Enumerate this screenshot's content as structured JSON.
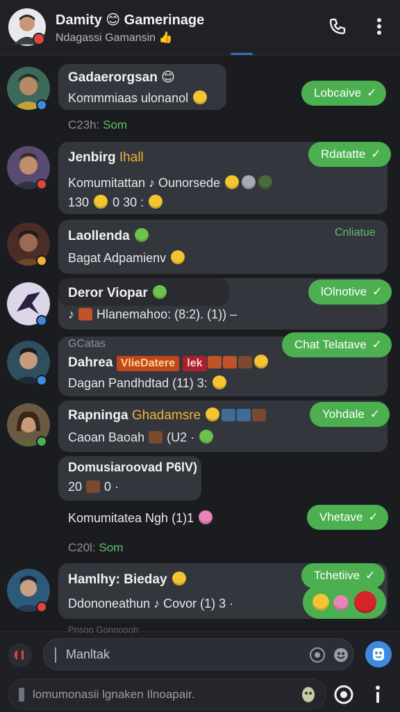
{
  "header": {
    "title": "Damity 😊 Gamerinage",
    "subtitle": "Ndagassi Gamansin 👍"
  },
  "messages": {
    "m1": {
      "name": "Gadaerorgsan 😊",
      "text": "Kommmiaas ulonanol",
      "time": "C23h:",
      "time_green": "Som",
      "status": "Lobcaive"
    },
    "m2": {
      "name": "Jenbirg",
      "name_gold": "Ihall",
      "text": "Komumitattan ♪ Ounorsede",
      "text2": "130 ",
      "text2b": "0 30 :",
      "status": "Rdatatte"
    },
    "m3": {
      "name": "Laollenda",
      "text": "Bagat Adpamienv",
      "status": "Cnliatue"
    },
    "m4": {
      "name": "Deror Viopar",
      "text": "♪ ",
      "text_b": " Hlanemahoo: (8:2). (1)) –",
      "status": "lOlnotive"
    },
    "m5": {
      "pre": "GCatas",
      "name": "Dahrea",
      "tag1": "VlieDatere",
      "tag2": "lek",
      "text": "Dagan Pandhdtad (11) 3:",
      "status": "Chat Telatave"
    },
    "m6": {
      "name": "Rapninga",
      "name_gold": "Ghadamsre",
      "text": "Caoan Baoah ",
      "text_b": " (U2 ·",
      "status": "Yohdale"
    },
    "m7": {
      "name": "Domusiaroovad P6lV)",
      "text": "20 ",
      "text_b": " 0 ·",
      "line2": "Komumitatea Ngh (1)1",
      "time": "C20l:",
      "time_green": "Som",
      "status": "Vhetave"
    },
    "m8": {
      "name": "Hamlhy: Bieday",
      "text": "Ddononeathun ♪ Covor (1) 3 ·",
      "status": "Tchetiive"
    }
  },
  "compose": {
    "placeholder": "Manltak",
    "bottom_placeholder": "lomumonasii lgnaken Ilnoapair.",
    "peek_text": "Pnsoo Gonnoooh"
  },
  "colors": {
    "accent_green": "#4cb050",
    "accent_blue": "#3d8be0",
    "bubble": "#34363d",
    "background": "#1b1c20"
  }
}
